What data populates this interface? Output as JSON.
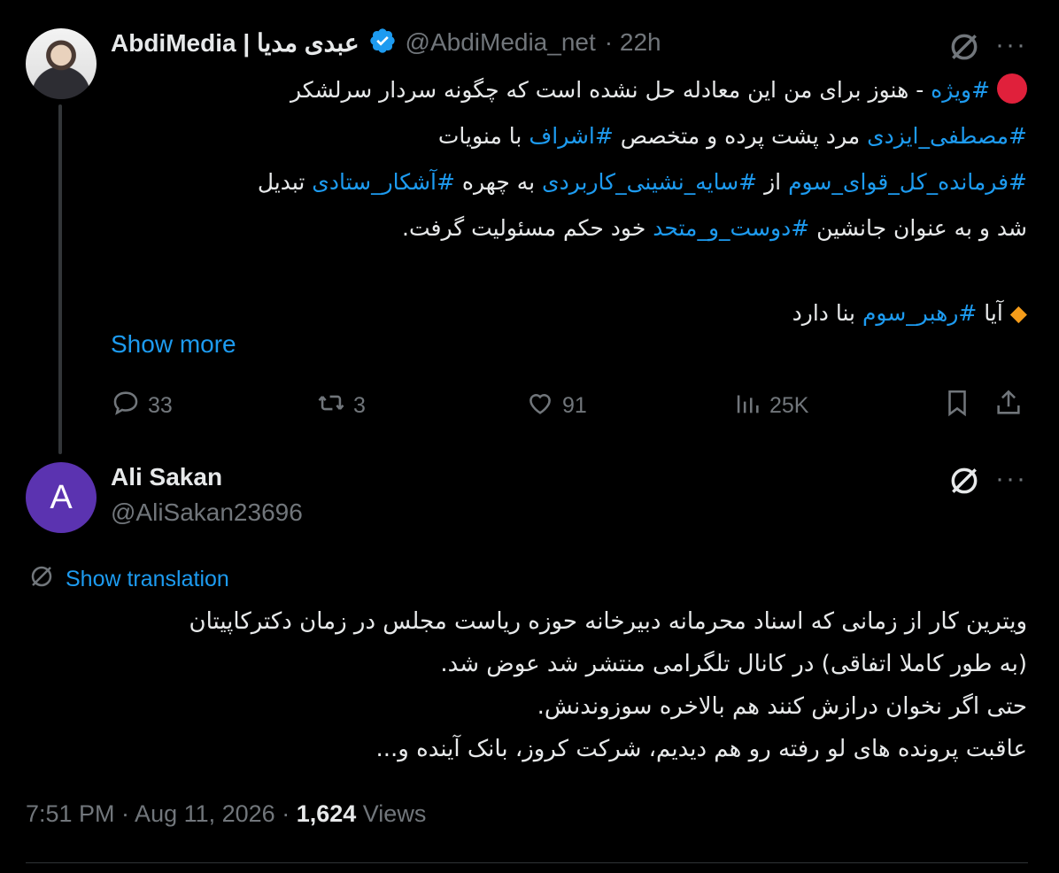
{
  "tweet": {
    "display_name": "AbdiMedia | عبدی مدیا",
    "handle": "@AbdiMedia_net",
    "time": "· 22h",
    "body": {
      "line1_tag": "#ویژه",
      "line1_text": " - هنوز برای من این معادله حل نشده است که چگونه سردار سرلشکر",
      "line2_tag1": "#مصطفی_ایزدی",
      "line2_text1": " مرد پشت پرده و متخصص ",
      "line2_tag2": "#اشراف",
      "line2_text2": " با منویات",
      "line3_tag1": "#فرمانده_کل_قوای_سوم",
      "line3_text1": " از ",
      "line3_tag2": "#سایه_نشینی_کاربردی",
      "line3_text2": " به چهره ",
      "line3_tag3": "#آشکار_ستادی",
      "line3_text3": " تبدیل",
      "line4_text1": "شد و به عنوان جانشین ",
      "line4_tag": "#دوست_و_متحد",
      "line4_text2": " خود حکم مسئولیت گرفت.",
      "line5_text1": "آیا ",
      "line5_tag": "#رهبر_سوم",
      "line5_text2": " بنا دارد"
    },
    "show_more": "Show more",
    "actions": {
      "replies": "33",
      "reposts": "3",
      "likes": "91",
      "views": "25K"
    }
  },
  "reply": {
    "avatar_letter": "A",
    "display_name": "Ali Sakan",
    "handle": "@AliSakan23696",
    "show_translation": "Show translation",
    "lines": [
      "ویترین کار از زمانی که اسناد محرمانه دبیرخانه حوزه ریاست مجلس در زمان دکترکاپیتان",
      "(به طور کاملا اتفاقی) در کانال تلگرامی منتشر شد عوض شد.",
      "حتی اگر نخوان درازش کنند هم بالاخره سوزوندنش.",
      "عاقبت پرونده های لو رفته رو هم دیدیم، شرکت کروز، بانک آینده و..."
    ],
    "timestamp": "7:51 PM · Aug 11, 2026 · ",
    "views_count": "1,624",
    "views_label": " Views"
  },
  "colors": {
    "background": "#000000",
    "text": "#e7e9ea",
    "muted": "#71767b",
    "accent": "#1d9bf0",
    "avatar_reply": "#5b33b0"
  },
  "icons": [
    "verified-badge-icon",
    "grok-icon",
    "more-icon",
    "reply-icon",
    "repost-icon",
    "like-icon",
    "views-icon",
    "bookmark-icon",
    "share-icon",
    "translate-icon"
  ]
}
